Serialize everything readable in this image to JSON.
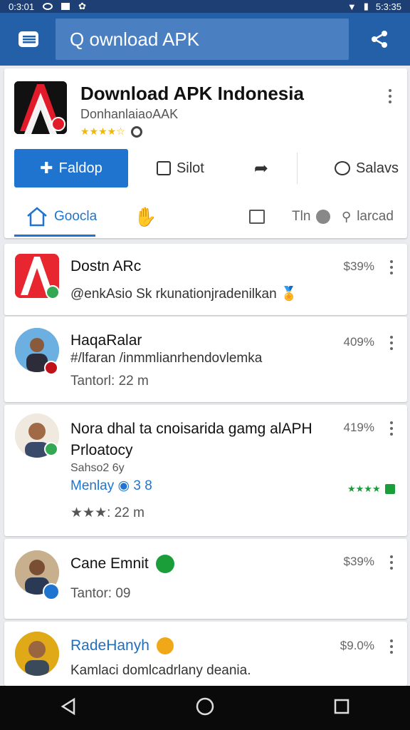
{
  "status": {
    "time_left": "0:3:01",
    "time_right": "5:3:35"
  },
  "appbar": {
    "search_text": "Q ownload APK"
  },
  "app": {
    "title": "Download APK Indonesia",
    "subtitle": "DonhanlaiaoAAK",
    "rating_stars": "★★★★☆",
    "actions": {
      "primary": "Faldop",
      "silot": "Silot",
      "salavs": "Salavs"
    },
    "tabs": {
      "home": "Goocla",
      "tab_b": "Tln",
      "tab_c": "larcad"
    }
  },
  "items": [
    {
      "name": "Dostn ARc",
      "line1": "@enkAsio Sk rkunationjradenilkan",
      "percent": "$39%"
    },
    {
      "name": "HaqaRalar",
      "line1": "#/lfaran /inmmlianrhendovlemka",
      "line2": "Tantorl: 22 m",
      "percent": "409%"
    },
    {
      "name": "Nora dhal ta cnoisarida gamg alAPH",
      "name2": "Prloatocy",
      "line1": "Sahso2 6y",
      "line2": "Menlay",
      "line2_extra": "◉ 3 8",
      "line3": "★★★: 22 m",
      "rating": "★★★★",
      "percent": "419%"
    },
    {
      "name": "Cane Emnit",
      "line1": "Tantor: 09",
      "percent": "$39%"
    },
    {
      "name": "RadeHanyh",
      "line1": "Kamlaci domlcadrlany deania.",
      "percent": "$9.0%"
    }
  ],
  "colors": {
    "appbar": "#2460a7",
    "accent": "#1f74d0",
    "status": "#1d3f74"
  }
}
